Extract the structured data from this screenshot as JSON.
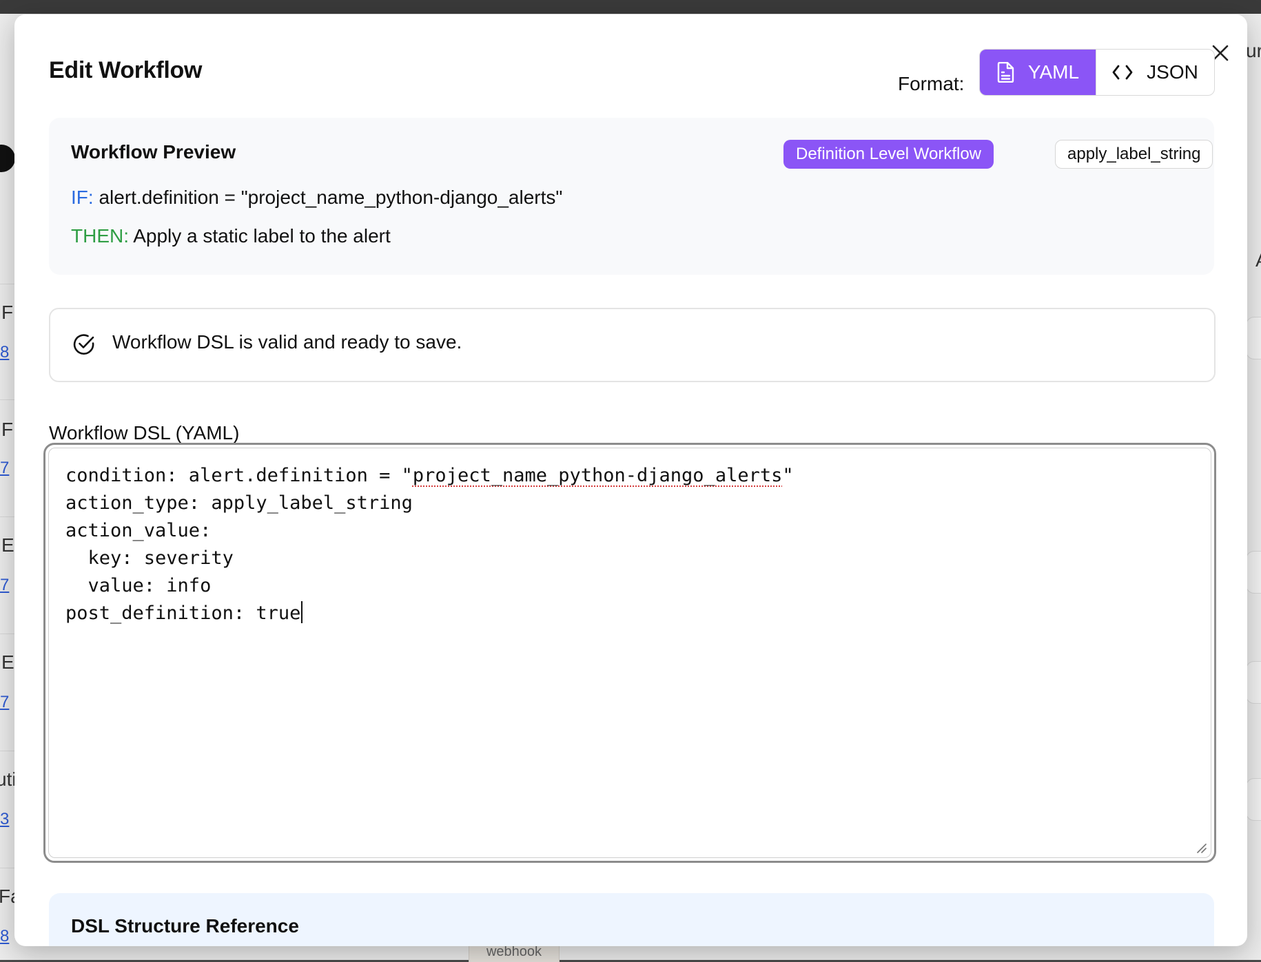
{
  "background": {
    "fragments": [
      "F",
      "F",
      "E",
      "E",
      "uti",
      "Fa",
      "ur",
      "A"
    ],
    "links": [
      "8",
      "7",
      "7",
      "7",
      "3",
      "8"
    ],
    "bottom_tab": "webhook"
  },
  "modal": {
    "title": "Edit Workflow",
    "close_icon": "close-icon",
    "format": {
      "label": "Format:",
      "options": [
        {
          "label": "YAML",
          "icon": "document-icon",
          "active": true
        },
        {
          "label": "JSON",
          "icon": "code-brackets-icon",
          "active": false
        }
      ]
    },
    "preview": {
      "title": "Workflow Preview",
      "badges": [
        "Definition Level Workflow",
        "apply_label_string"
      ],
      "if_keyword": "IF:",
      "if_text": " alert.definition = \"project_name_python-django_alerts\"",
      "then_keyword": "THEN:",
      "then_text": " Apply a static label to the alert"
    },
    "validation": {
      "icon": "check-circle-icon",
      "message": "Workflow DSL is valid and ready to save."
    },
    "dsl": {
      "label": "Workflow DSL (YAML)",
      "lines": [
        {
          "before": "condition: alert.definition = \"",
          "flagged": "project_name_python-django_alerts",
          "after": "\""
        },
        {
          "text": "action_type: apply_label_string"
        },
        {
          "text": "action_value:"
        },
        {
          "text": "  key: severity"
        },
        {
          "text": "  value: info"
        },
        {
          "text": "post_definition: true"
        }
      ]
    },
    "reference": {
      "title": "DSL Structure Reference"
    }
  },
  "colors": {
    "accent": "#8b55f6",
    "if_keyword": "#2b6be0",
    "then_keyword": "#2f9e44",
    "reference_bg": "#eef5ff"
  }
}
